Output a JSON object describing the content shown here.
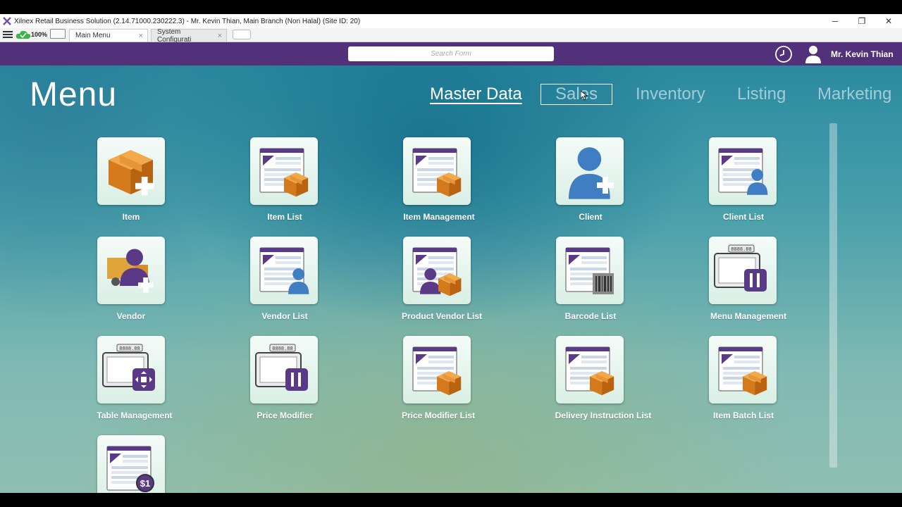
{
  "window": {
    "title": "Xilnex Retail Business Solution (2.14.71000.230222.3) -  Mr. Kevin Thian, Main Branch (Non Halal)  (Site ID: 20)",
    "minimize": "─",
    "maximize": "❐",
    "close": "✕"
  },
  "tabbar": {
    "zoom": "100%",
    "tabs": [
      {
        "label": "Main Menu",
        "close": "×"
      },
      {
        "label": "System Configurati",
        "close": "×"
      }
    ]
  },
  "header": {
    "search_placeholder": "Search Form",
    "username": "Mr. Kevin Thian"
  },
  "menu": {
    "title": "Menu",
    "categories": [
      "Master Data",
      "Sales",
      "Inventory",
      "Listing",
      "Marketing"
    ]
  },
  "tiles": [
    {
      "label": "Item",
      "icon": "box-add-icon"
    },
    {
      "label": "Item List",
      "icon": "list-box-icon"
    },
    {
      "label": "Item Management",
      "icon": "list-box-icon"
    },
    {
      "label": "Client",
      "icon": "person-add-icon"
    },
    {
      "label": "Client List",
      "icon": "list-person-icon"
    },
    {
      "label": "Vendor",
      "icon": "truck-person-icon"
    },
    {
      "label": "Vendor List",
      "icon": "list-person-icon"
    },
    {
      "label": "Product Vendor List",
      "icon": "list-person-box-icon"
    },
    {
      "label": "Barcode List",
      "icon": "list-barcode-icon"
    },
    {
      "label": "Menu Management",
      "icon": "pos-cutlery-icon"
    },
    {
      "label": "Table Management",
      "icon": "pos-table-icon"
    },
    {
      "label": "Price Modifier",
      "icon": "pos-cutlery-icon"
    },
    {
      "label": "Price Modifier List",
      "icon": "list-box-icon"
    },
    {
      "label": "Delivery Instruction List",
      "icon": "list-box-icon"
    },
    {
      "label": "Item Batch List",
      "icon": "list-box-icon"
    },
    {
      "label": "",
      "icon": "list-price-icon"
    }
  ],
  "colors": {
    "header": "#53307a",
    "accent_purple": "#5a3a86",
    "box_orange": "#e08a2a"
  }
}
